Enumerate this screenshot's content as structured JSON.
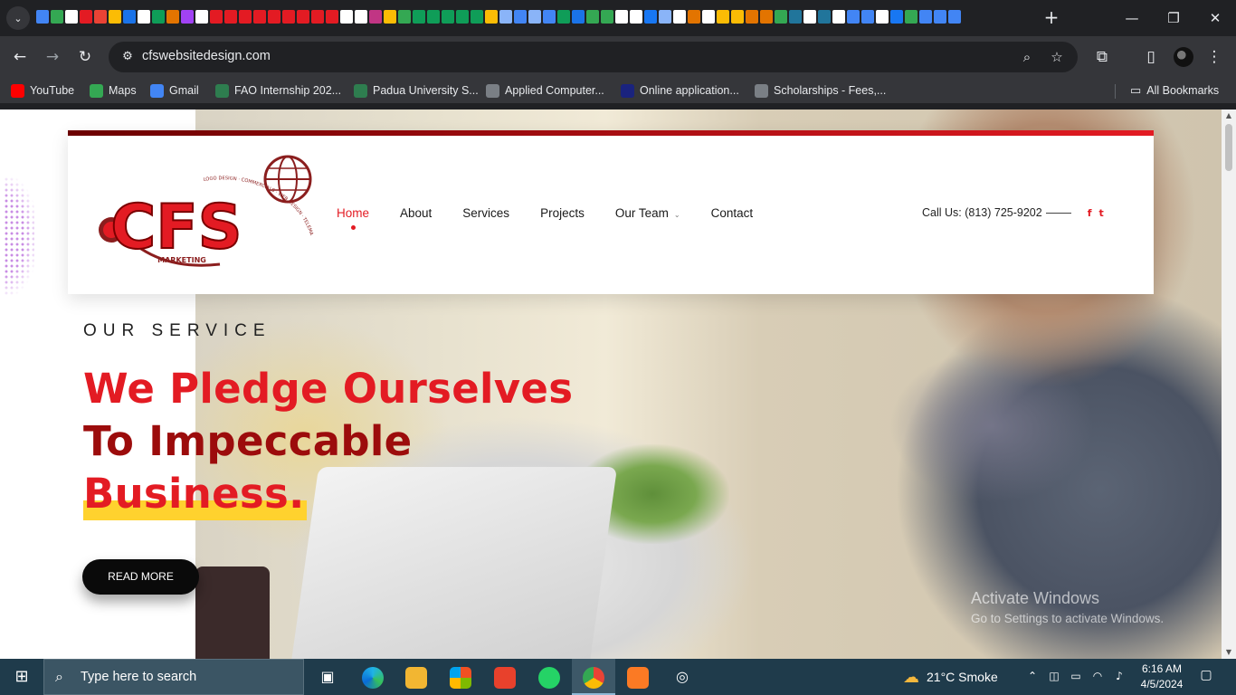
{
  "browser": {
    "address_url": "cfswebsitedesign.com",
    "bookmarks": [
      {
        "label": "YouTube",
        "icon": "youtube-icon",
        "color": "#ff0000"
      },
      {
        "label": "Maps",
        "icon": "maps-icon",
        "color": "#34a853"
      },
      {
        "label": "Gmail",
        "icon": "google-icon",
        "color": "#4285f4"
      },
      {
        "label": "FAO Internship 202...",
        "icon": "fao-icon",
        "color": "#2e7d4f"
      },
      {
        "label": "Padua University S...",
        "icon": "padua-icon",
        "color": "#2e7d4f"
      },
      {
        "label": "Applied Computer...",
        "icon": "document-icon",
        "color": "#7a7f85"
      },
      {
        "label": "Online application...",
        "icon": "globe-icon",
        "color": "#1a237e"
      },
      {
        "label": "Scholarships - Fees,...",
        "icon": "document-icon",
        "color": "#7a7f85"
      }
    ],
    "all_bookmarks_label": "All Bookmarks"
  },
  "site": {
    "logo": {
      "main": "CFS",
      "sub": "MARKETING",
      "arc_text": "LOGO DESIGN · COMMERCIALS · WEB DESIGN · TELEMARKETING · SEO · PHOTO SHOOTS"
    },
    "nav": [
      {
        "label": "Home",
        "active": true
      },
      {
        "label": "About"
      },
      {
        "label": "Services"
      },
      {
        "label": "Projects"
      },
      {
        "label": "Our Team",
        "dropdown": true
      },
      {
        "label": "Contact"
      }
    ],
    "call_text": "Call Us: (813) 725-9202",
    "social": [
      {
        "glyph": "f",
        "icon": "facebook-icon"
      },
      {
        "glyph": "t",
        "icon": "twitter-icon"
      }
    ],
    "hero": {
      "eyebrow": "OUR SERVICE",
      "headline_line1": "We Pledge Ourselves",
      "headline_line2": "To Impeccable",
      "headline_line3": "Business.",
      "cta": "READ MORE"
    },
    "accent_color": "#e31b23",
    "dark_red": "#9c0c0c",
    "highlight_color": "#ffd22e"
  },
  "watermark": {
    "line1": "Activate Windows",
    "line2": "Go to Settings to activate Windows."
  },
  "taskbar": {
    "search_placeholder": "Type here to search",
    "weather": "21°C  Smoke",
    "time": "6:16 AM",
    "date": "4/5/2024"
  }
}
